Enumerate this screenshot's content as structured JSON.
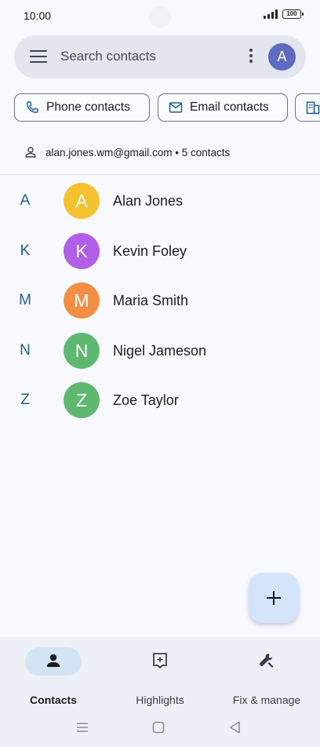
{
  "status_bar": {
    "time": "10:00",
    "battery": "100"
  },
  "search": {
    "placeholder": "Search contacts",
    "account_initial": "A"
  },
  "filters": [
    {
      "label": "Phone contacts",
      "icon": "phone-icon"
    },
    {
      "label": "Email contacts",
      "icon": "email-icon"
    },
    {
      "label": "",
      "icon": "building-icon"
    }
  ],
  "account": {
    "summary": "alan.jones.wm@gmail.com • 5 contacts"
  },
  "contacts": [
    {
      "letter": "A",
      "initial": "A",
      "name": "Alan Jones",
      "color": "#f6c12f"
    },
    {
      "letter": "K",
      "initial": "K",
      "name": "Kevin Foley",
      "color": "#b15ee8"
    },
    {
      "letter": "M",
      "initial": "M",
      "name": "Maria Smith",
      "color": "#f48e45"
    },
    {
      "letter": "N",
      "initial": "N",
      "name": "Nigel Jameson",
      "color": "#5fb870"
    },
    {
      "letter": "Z",
      "initial": "Z",
      "name": "Zoe Taylor",
      "color": "#5fb870"
    }
  ],
  "bottom_nav": [
    {
      "label": "Contacts",
      "icon": "person-icon",
      "active": true
    },
    {
      "label": "Highlights",
      "icon": "highlights-icon",
      "active": false
    },
    {
      "label": "Fix & manage",
      "icon": "wrench-icon",
      "active": false
    }
  ],
  "colors": {
    "accent_pill": "#d3e4f5",
    "fab": "#d3e4fb",
    "letter": "#1f5e8a"
  }
}
